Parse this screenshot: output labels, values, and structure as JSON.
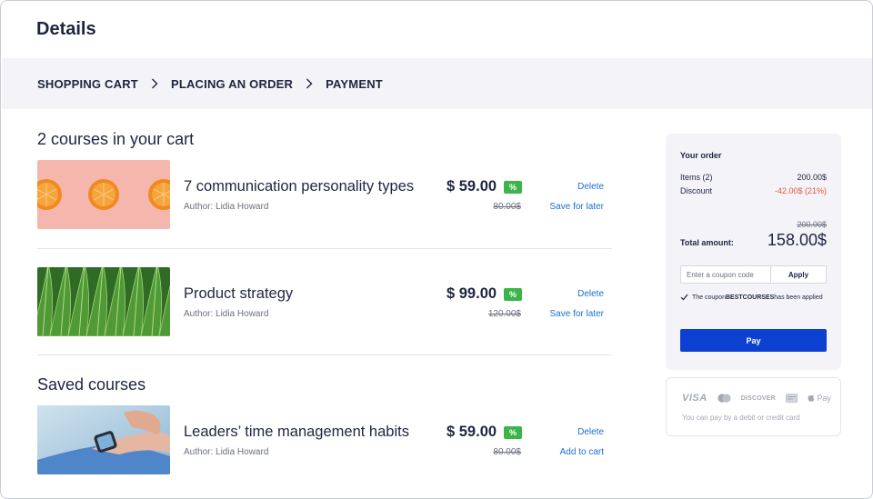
{
  "page": {
    "title": "Details"
  },
  "steps": [
    {
      "label": "SHOPPING CART"
    },
    {
      "label": "PLACING AN ORDER"
    },
    {
      "label": "PAYMENT"
    }
  ],
  "cart": {
    "heading": "2 courses in your cart",
    "items": [
      {
        "title": "7 communication personality types",
        "author": "Author: Lidia Howard",
        "price": "$ 59.00",
        "badge": "%",
        "old_price": "80.00$",
        "action1": "Delete",
        "action2": "Save for later"
      },
      {
        "title": "Product strategy",
        "author": "Author: Lidia Howard",
        "price": "$ 99.00",
        "badge": "%",
        "old_price": "120.00$",
        "action1": "Delete",
        "action2": "Save for later"
      }
    ]
  },
  "saved": {
    "heading": "Saved courses",
    "items": [
      {
        "title": "Leaders’ time management habits",
        "author": "Author: Lidia Howard",
        "price": "$ 59.00",
        "badge": "%",
        "old_price": "80.00$",
        "action1": "Delete",
        "action2": "Add to cart"
      }
    ]
  },
  "order": {
    "title": "Your order",
    "items_label": "Items (2)",
    "items_value": "200.00$",
    "discount_label": "Discount",
    "discount_value": "-42.00$ (21%)",
    "old_total": "200.00$",
    "total_label": "Total amount:",
    "total_value": "158.00$",
    "coupon_placeholder": "Enter a coupon code",
    "apply_label": "Apply",
    "applied_prefix": "The coupon ",
    "applied_code": "BESTCOURSES",
    "applied_suffix": " has been applied",
    "pay_label": "Pay"
  },
  "payment": {
    "visa": "VISA",
    "discover": "DISCOVER",
    "apple_pay": "Pay",
    "note": "You can pay by a debit or credit card"
  },
  "colors": {
    "accent": "#0b40d1",
    "link": "#1a6fd1",
    "discount": "#e8563a",
    "badge": "#3bb54a",
    "panel": "#f3f3f8"
  }
}
